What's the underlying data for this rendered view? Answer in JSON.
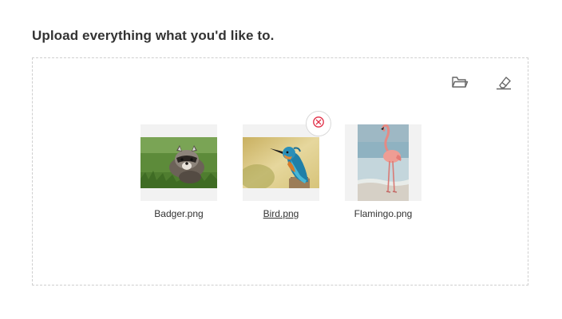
{
  "heading": "Upload everything what you'd like to.",
  "toolbar": {
    "open_icon": "folder-open-icon",
    "clear_icon": "eraser-icon"
  },
  "files": [
    {
      "name": "Badger.png",
      "thumbnail": "badger-photo"
    },
    {
      "name": "Bird.png",
      "thumbnail": "kingfisher-photo",
      "hovered": true
    },
    {
      "name": "Flamingo.png",
      "thumbnail": "flamingo-photo"
    }
  ],
  "remove_icon": "close-icon",
  "colors": {
    "remove_accent": "#e02a43",
    "icon_gray": "#666666",
    "thumb_bg": "#f2f2f2",
    "border": "#cfcfcf"
  }
}
